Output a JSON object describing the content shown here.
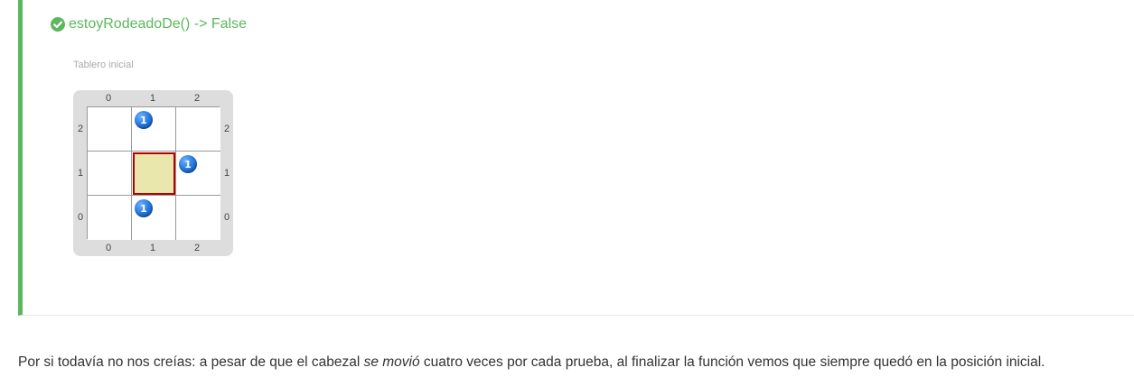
{
  "result": {
    "status_icon": "check-circle-icon",
    "title": "estoyRodeadoDe() -> False",
    "accent_color": "#5cb85c"
  },
  "board": {
    "caption": "Tablero inicial",
    "column_labels": [
      "0",
      "1",
      "2"
    ],
    "row_labels": [
      "2",
      "1",
      "0"
    ],
    "head": {
      "x": 1,
      "y": 1,
      "color": "#b80000"
    },
    "balls": [
      {
        "x": 1,
        "y": 2,
        "color": "azul",
        "count": "1"
      },
      {
        "x": 2,
        "y": 1,
        "color": "azul",
        "count": "1"
      },
      {
        "x": 1,
        "y": 0,
        "color": "azul",
        "count": "1"
      }
    ]
  },
  "paragraph": {
    "before": "Por si todavía no nos creías: a pesar de que el cabezal ",
    "emphasis": "se movió",
    "after": " cuatro veces por cada prueba, al finalizar la función vemos que siempre quedó en la posición inicial."
  }
}
